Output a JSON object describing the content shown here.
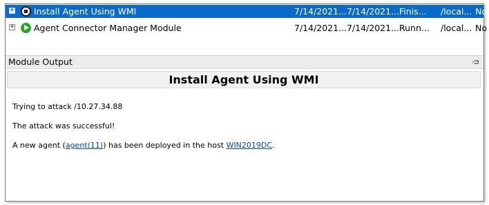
{
  "tasks": [
    {
      "name": "Install Agent Using WMI",
      "start": "7/14/2021...",
      "end": "7/14/2021...",
      "state": "Finis...",
      "owner": "/local...",
      "flag": "No",
      "status_icon": "stopped-icon",
      "selected": true
    },
    {
      "name": "Agent Connector Manager Module",
      "start": "7/14/2021...",
      "end": "7/14/2021...",
      "state": "Runn...",
      "owner": "/local...",
      "flag": "No",
      "status_icon": "play-icon",
      "selected": false
    }
  ],
  "panel": {
    "title": "Module Output",
    "pin_glyph": "ᴞ",
    "heading": "Install Agent Using WMI",
    "line1": "Trying to attack /10.27.34.88",
    "line2": "The attack was successful!",
    "line3_pre": "A new agent (",
    "line3_agent": "agent(11)",
    "line3_mid": ") has been deployed in the host ",
    "line3_host": "WIN2019DC",
    "line3_post": "."
  },
  "colors": {
    "selection": "#0a6ac9",
    "link": "#0645ad",
    "running": "#2aa52a"
  }
}
